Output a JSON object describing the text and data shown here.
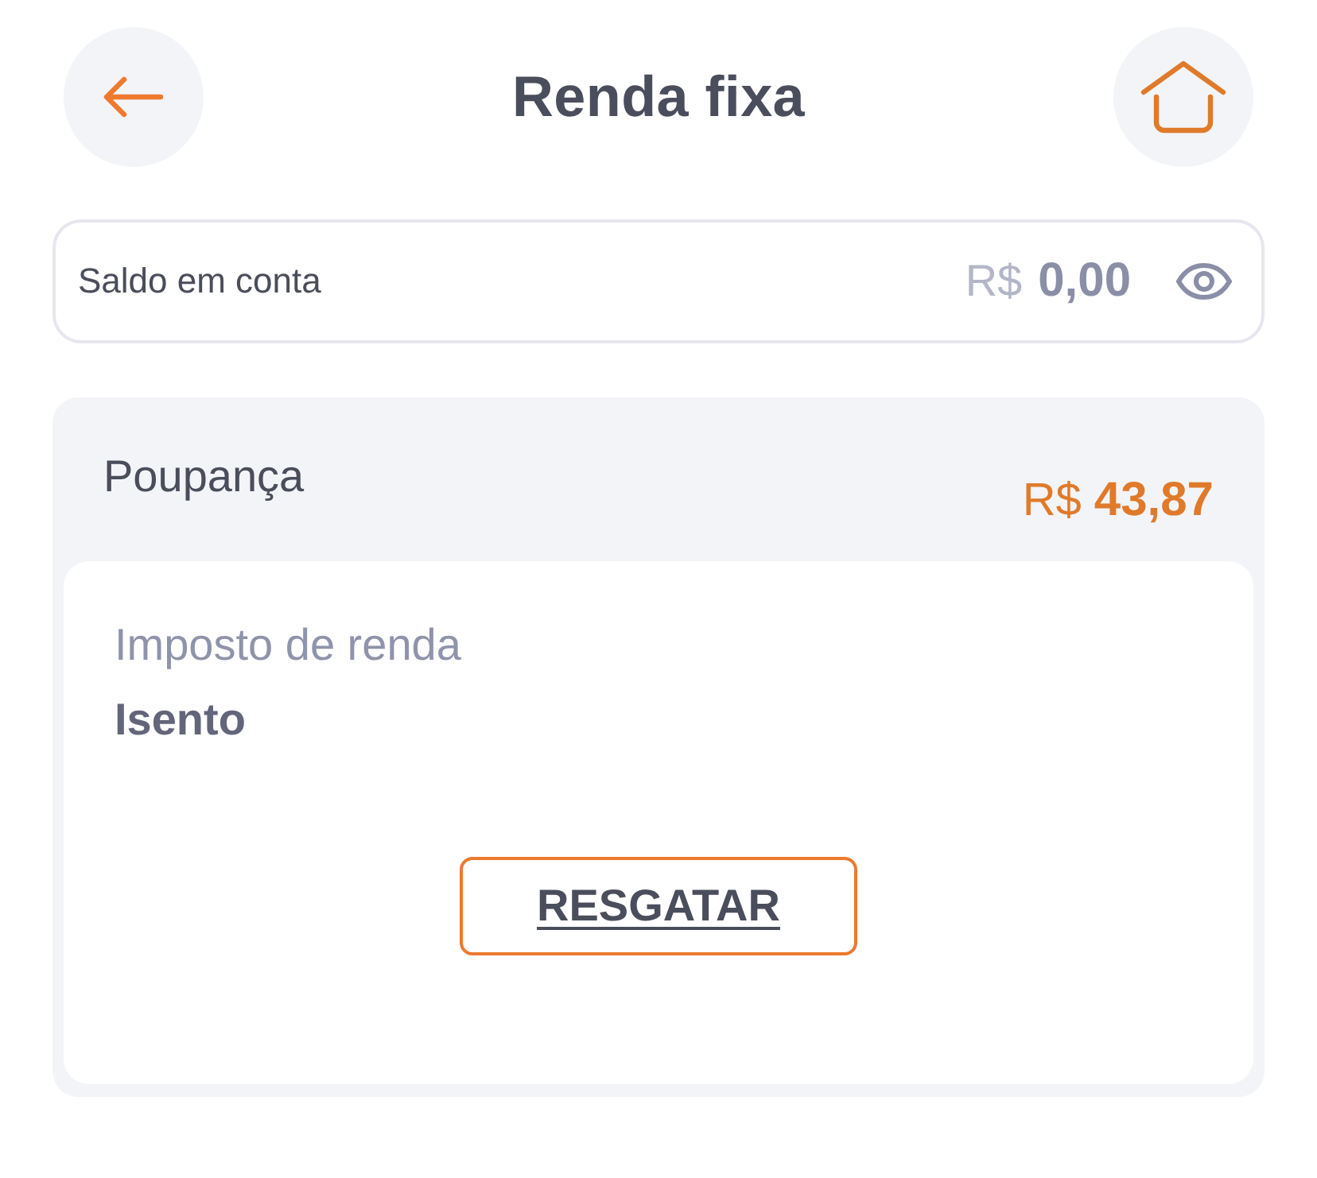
{
  "header": {
    "title": "Renda fixa"
  },
  "balance": {
    "label": "Saldo em conta",
    "currency": "R$",
    "amount": "0,00"
  },
  "product": {
    "name": "Poupança",
    "currency": "R$",
    "amount": "43,87",
    "details": [
      {
        "label": "Imposto de renda",
        "value": "Isento"
      }
    ],
    "action": "RESGATAR"
  }
}
